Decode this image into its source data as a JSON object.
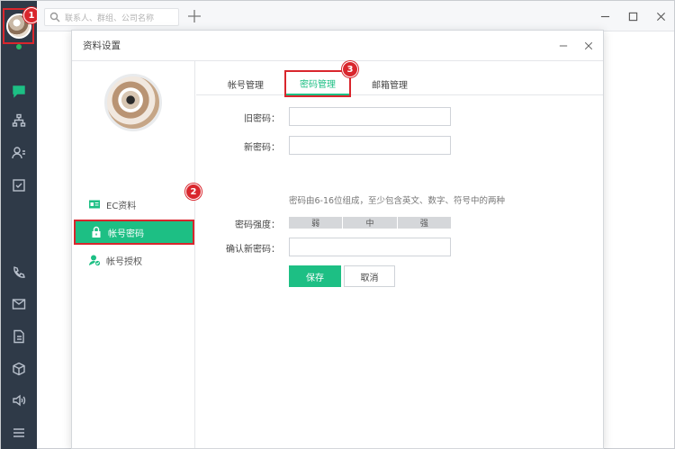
{
  "search": {
    "placeholder": "联系人、群组、公司名称"
  },
  "dialog": {
    "title": "资料设置",
    "nav": [
      {
        "label": "EC资料",
        "icon": "id-card-icon"
      },
      {
        "label": "帐号密码",
        "icon": "lock-icon"
      },
      {
        "label": "帐号授权",
        "icon": "user-check-icon"
      }
    ],
    "tabs": [
      {
        "label": "帐号管理"
      },
      {
        "label": "密码管理"
      },
      {
        "label": "邮箱管理"
      }
    ],
    "form": {
      "old_password_label": "旧密码：",
      "new_password_label": "新密码：",
      "hint": "密码由6-16位组成，至少包含英文、数字、符号中的两种",
      "strength_label": "密码强度：",
      "strength_levels": [
        "弱",
        "中",
        "强"
      ],
      "confirm_label": "确认新密码：",
      "save_label": "保存",
      "cancel_label": "取消"
    }
  },
  "steps": [
    "1",
    "2",
    "3"
  ],
  "colors": {
    "accent": "#1dbf84",
    "sidebar": "#2f3a48",
    "highlight": "#d9262d"
  }
}
